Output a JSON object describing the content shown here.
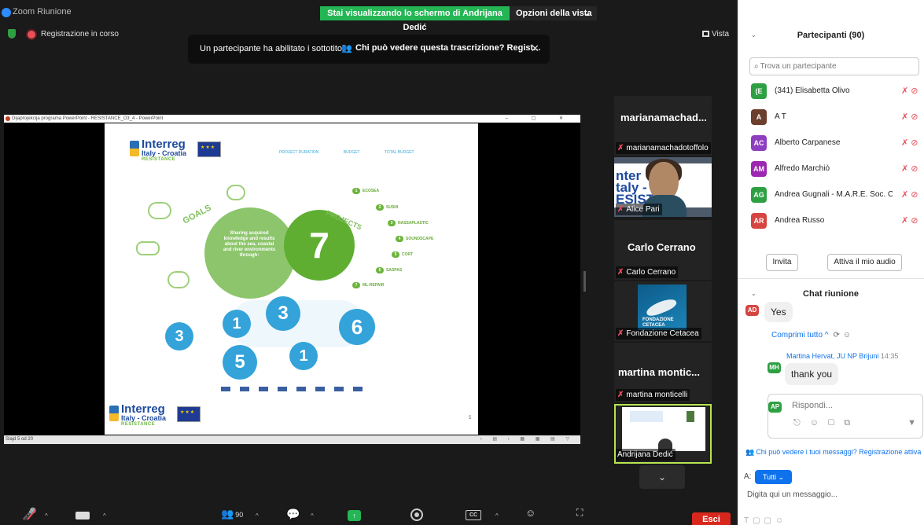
{
  "window": {
    "title": "Zoom Riunione",
    "share_banner": "Stai visualizzando lo schermo di Andrijana Dedić",
    "view_options": "Opzioni della vista",
    "controls": [
      "–",
      "□",
      "✕"
    ]
  },
  "meeting": {
    "recording_label": "Registrazione in corso",
    "view_label": "Vista",
    "caption_notice": "Un partecipante ha abilitato i sottotitoli",
    "caption_who": "Chi può vedere questa trascrizione? Regist...",
    "caption_close": "✕"
  },
  "ppt": {
    "title": "Dijaprojekcija programa PowerPoint - RESISTANCE_D3_4 - PowerPoint",
    "controls": "–  ▢  ✕",
    "status": "Slajd 5 od 20",
    "nav": "‹ ▤ › ▦ ▦ ▤ ▽"
  },
  "slide": {
    "brand": "Interreg",
    "sub": "Italy - Croatia",
    "resistance": "RESISTANCE",
    "header_items": [
      "PROJECT DURATION",
      "BUDGET",
      "TOTAL BUDGET"
    ],
    "goals": "GOALS",
    "goal_text": "Sharing acquired knowledge and results about the sea, coastal and river environments through:",
    "projects": "PROJECTS",
    "project_count": "7",
    "project_items": [
      {
        "num": "1",
        "name": "ECOSEA"
      },
      {
        "num": "2",
        "name": "SUSHI"
      },
      {
        "num": "3",
        "name": "NASSAPLASTIC"
      },
      {
        "num": "4",
        "name": "SOUNDSCAPE"
      },
      {
        "num": "5",
        "name": "CORT"
      },
      {
        "num": "6",
        "name": "SASPAS"
      },
      {
        "num": "7",
        "name": "ML-REPAIR"
      }
    ],
    "numbers": [
      "3",
      "1",
      "3",
      "6",
      "5",
      "1"
    ],
    "slide_number": "5"
  },
  "gallery": [
    {
      "name": "marianamachad...",
      "label": "marianamachadotoffolo",
      "muted": true
    },
    {
      "name": "",
      "label": "Alice Pari",
      "muted": true
    },
    {
      "name": "Carlo Cerrano",
      "label": "Carlo Cerrano",
      "muted": true
    },
    {
      "name": "",
      "label": "Fondazione Cetacea",
      "muted": true
    },
    {
      "name": "martina  montic...",
      "label": "martina monticelli",
      "muted": true
    },
    {
      "name": "",
      "label": "Andrijana Dedić",
      "muted": false
    }
  ],
  "gallery_banner_text": "nter\ntaly - C\nESIST",
  "cetacea_text": "FONDAZIONE\nCETACEA",
  "toolbar": {
    "participants_count": "90",
    "leave": "Esci",
    "cc": "CC"
  },
  "participants": {
    "title": "Partecipanti (90)",
    "search_placeholder": "Trova un partecipante",
    "list": [
      {
        "initials": "(E",
        "name": "(341) Elisabetta Olivo",
        "color": "#2ea043"
      },
      {
        "initials": "A",
        "name": "A T",
        "color": "#6b3e2e"
      },
      {
        "initials": "AC",
        "name": "Alberto Carpanese",
        "color": "#8e3fbf"
      },
      {
        "initials": "AM",
        "name": "Alfredo Marchiò",
        "color": "#9c27b0"
      },
      {
        "initials": "AG",
        "name": "Andrea Gugnali - M.A.R.E. Soc. C...",
        "color": "#2ea043"
      },
      {
        "initials": "AR",
        "name": "Andrea Russo",
        "color": "#d64541"
      }
    ],
    "invite": "Invita",
    "audio": "Attiva il mio audio"
  },
  "chat": {
    "title": "Chat riunione",
    "messages": [
      {
        "initials": "AD",
        "text": "Yes",
        "color": "#d64541"
      },
      {
        "sender": "Martina Hervat, JU NP Brijuni",
        "time": "14:35",
        "initials": "MH",
        "text": "thank you",
        "color": "#2ea043"
      }
    ],
    "collapse_all": "Comprimi tutto ^",
    "reply_initials": "AP",
    "reply_placeholder": "Rispondi...",
    "privacy": "Chi può vedere i tuoi messaggi? Registrazione attiva",
    "to_label": "A:",
    "to_value": "Tutti",
    "message_placeholder": "Digita qui un messaggio..."
  }
}
